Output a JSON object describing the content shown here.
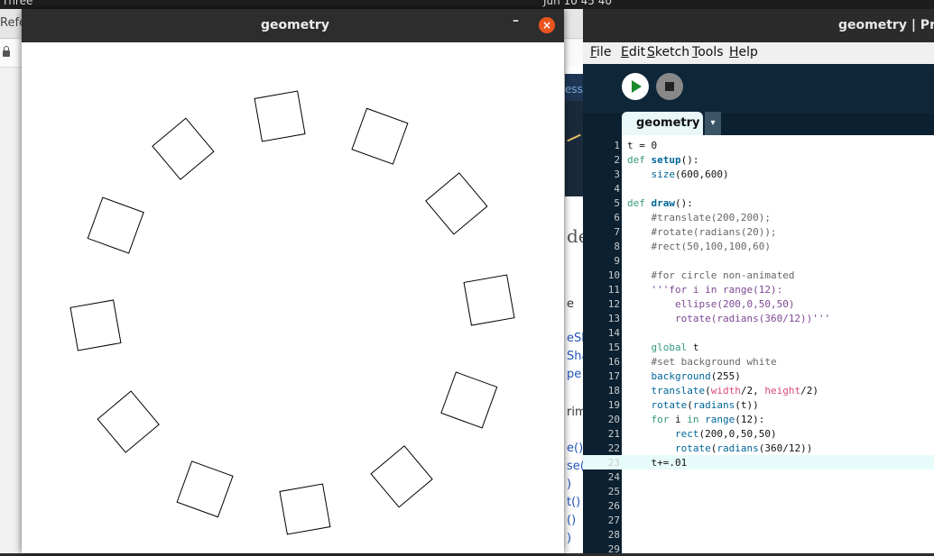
{
  "desktop": {
    "top_left": "Three",
    "top_center": "Jun 10 45 40"
  },
  "browser": {
    "tab_text": "Refe",
    "banner_text": "essi",
    "heading_fragment": "de",
    "side_links": [
      "e",
      "eSh",
      "Sha",
      "pe",
      "rim",
      "e()",
      "se()",
      ")",
      "t()",
      "()",
      ")"
    ]
  },
  "ide": {
    "title": "geometry | Pro",
    "menu": [
      "File",
      "Edit",
      "Sketch",
      "Tools",
      "Help"
    ],
    "tab_label": "geometry",
    "tab_menu_icon": "▾",
    "code_lines": [
      "t = 0",
      "def setup():",
      "    size(600,600)",
      "",
      "def draw():",
      "    #translate(200,200);",
      "    #rotate(radians(20));",
      "    #rect(50,100,100,60)",
      "",
      "    #for circle non-animated",
      "    '''for i in range(12):",
      "        ellipse(200,0,50,50)",
      "        rotate(radians(360/12))'''",
      "",
      "    global t",
      "    #set background white",
      "    background(255)",
      "    translate(width/2, height/2)",
      "    rotate(radians(t))",
      "    for i in range(12):",
      "        rect(200,0,50,50)",
      "        rotate(radians(360/12))",
      "    t+=.01",
      "",
      "",
      "",
      "",
      "",
      ""
    ],
    "current_line": 23
  },
  "sketch_window": {
    "title": "geometry",
    "minimize_icon": "–",
    "close_icon": "×",
    "sketch": {
      "square_count": 12,
      "square_size": 50,
      "radius": 200,
      "angle_step_deg": 30,
      "rotation_offset_deg": 20
    }
  }
}
